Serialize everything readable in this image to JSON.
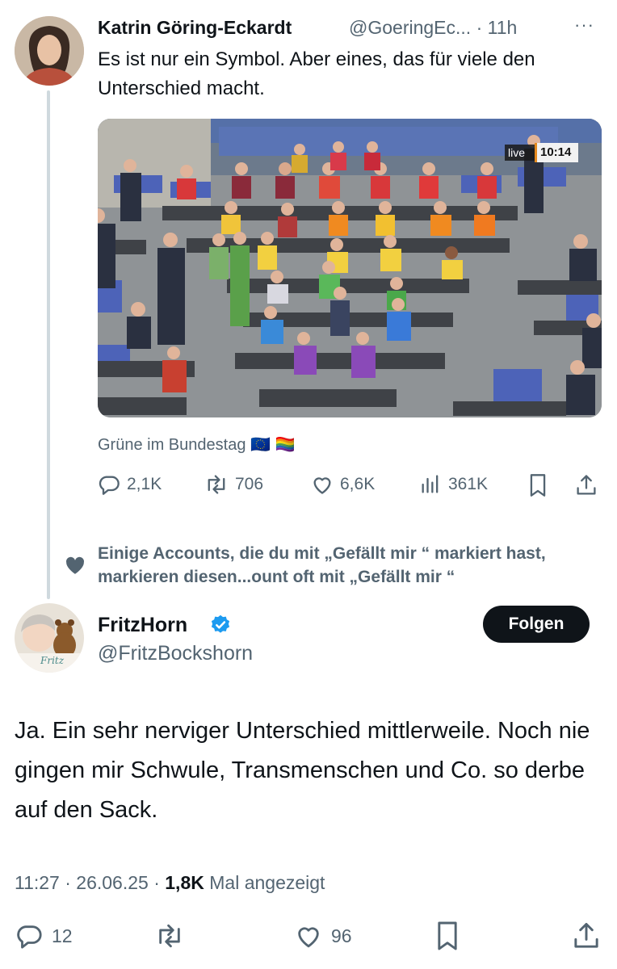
{
  "parent": {
    "author_name": "Katrin Göring-Eckardt",
    "handle_time": "@GoeringEc... · 11h",
    "more": "···",
    "text": "Es ist nur ein Symbol. Aber eines, das für viele den Unterschied macht.",
    "media": {
      "live_label": "live",
      "clock": "10:14"
    },
    "source": "Grüne im Bundestag 🇪🇺 🏳️‍🌈",
    "actions": {
      "replies": "2,1K",
      "reposts": "706",
      "likes": "6,6K",
      "views": "361K"
    },
    "icons": [
      "reply-icon",
      "repost-icon",
      "like-icon",
      "views-icon",
      "bookmark-icon",
      "share-icon"
    ]
  },
  "social_context": {
    "text": "Einige Accounts, die du mit „Gefällt mir “ markiert hast, markieren diesen...ount oft mit „Gefällt mir “",
    "icon": "heart-icon"
  },
  "reply": {
    "author_name": "FritzHorn",
    "verified": true,
    "handle": "@FritzBockshorn",
    "follow_label": "Folgen",
    "avatar_caption": "Fritz",
    "text": "Ja. Ein sehr nerviger Unterschied mittlerweile. Noch nie gingen mir Schwule, Transmenschen und Co. so derbe auf den Sack.",
    "time": "11:27 · 26.06.25 · ",
    "views_count": "1,8K",
    "views_label": "Mal angezeigt",
    "actions": {
      "replies": "12",
      "reposts": "",
      "likes": "96"
    }
  },
  "colors": {
    "text": "#0f1419",
    "secondary": "#536471",
    "thread_line": "#cfd9de",
    "verified": "#1d9bf0",
    "follow_bg": "#0f1419"
  }
}
